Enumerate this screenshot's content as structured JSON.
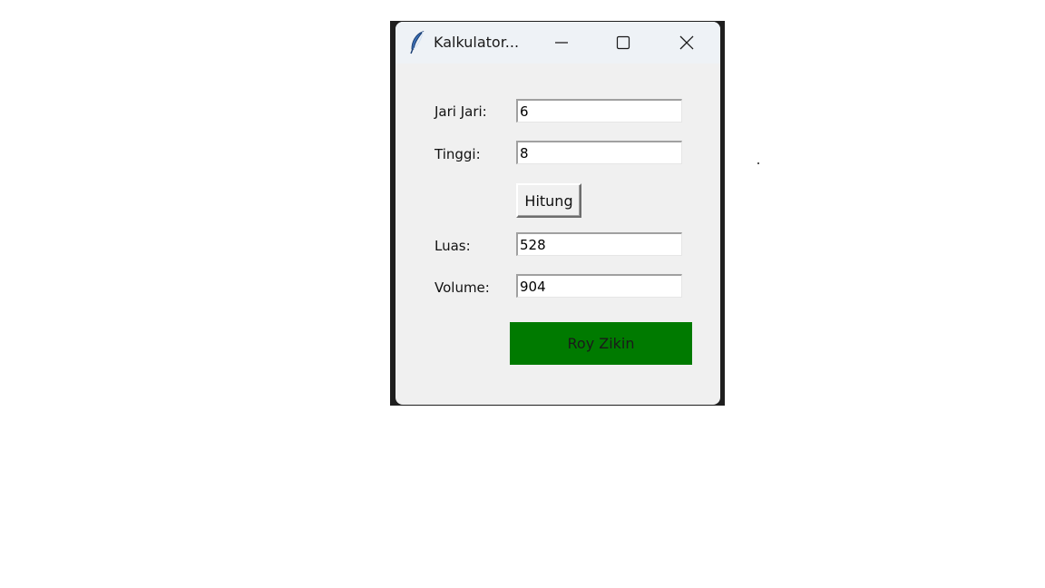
{
  "window": {
    "title": "Kalkulator...",
    "app_icon": "tk-feather-icon",
    "controls": [
      "minimize-icon",
      "maximize-icon",
      "close-icon"
    ]
  },
  "form": {
    "jari_label": "Jari Jari:",
    "jari_value": "6",
    "tinggi_label": "Tinggi:",
    "tinggi_value": "8",
    "hitung_label": "Hitung",
    "luas_label": "Luas:",
    "luas_value": "528",
    "volume_label": "Volume:",
    "volume_value": "904",
    "name_label": "Roy Zikin"
  },
  "colors": {
    "name_background": "#007a00",
    "window_background": "#f0f0f0",
    "titlebar_background": "#eef2f6"
  }
}
